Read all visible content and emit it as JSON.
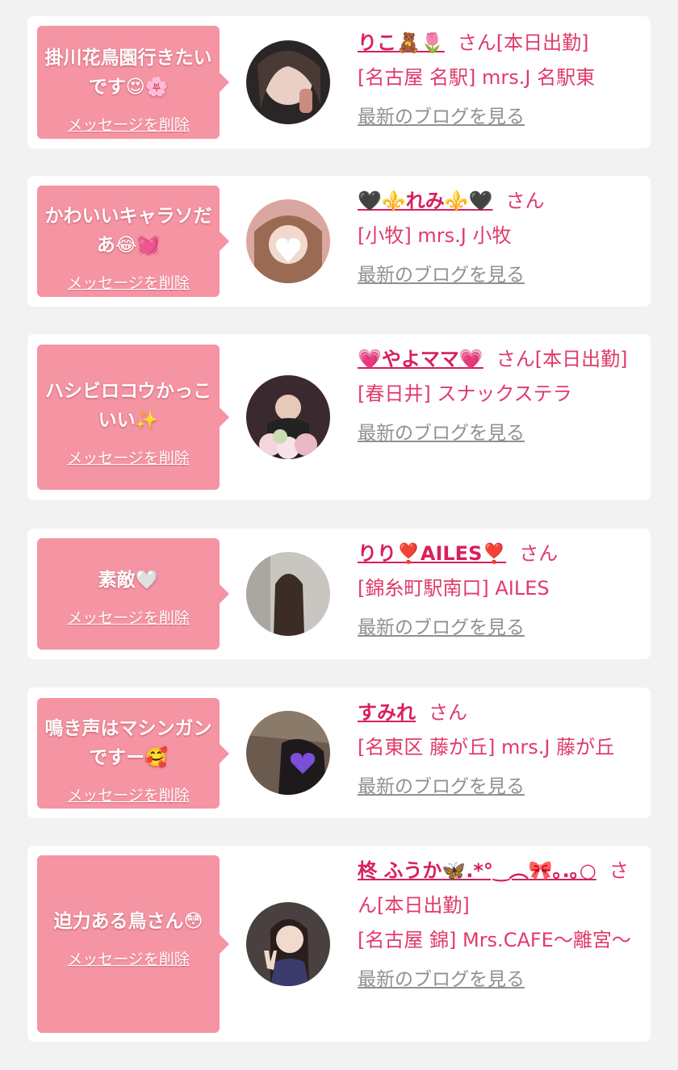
{
  "cards": [
    {
      "message": "掛川花鳥園行きたいです😍🌸",
      "delete_label": "メッセージを削除",
      "name": "りこ🧸🌷",
      "suffix": "さん[本日出勤]",
      "shop": "[名古屋 名駅] mrs.J 名駅東",
      "blog_label": "最新のブログを見る"
    },
    {
      "message": "かわいいキャラソだあ😂💓",
      "delete_label": "メッセージを削除",
      "name": "🖤⚜️れみ⚜️🖤",
      "suffix": "さん",
      "shop": "[小牧] mrs.J 小牧",
      "blog_label": "最新のブログを見る"
    },
    {
      "message": "ハシビロコウかっこいい✨",
      "delete_label": "メッセージを削除",
      "name": "💗やよママ💗",
      "suffix": "さん[本日出勤]",
      "shop": "[春日井] スナックステラ",
      "blog_label": "最新のブログを見る"
    },
    {
      "message": "素敵🤍",
      "delete_label": "メッセージを削除",
      "name": "りり❣️AILES❣️",
      "suffix": "さん",
      "shop": "[錦糸町駅南口] AILES",
      "blog_label": "最新のブログを見る"
    },
    {
      "message": "鳴き声はマシンガンですー🥰",
      "delete_label": "メッセージを削除",
      "name": "すみれ",
      "suffix": "さん",
      "shop": "[名東区 藤が丘] mrs.J 藤が丘",
      "blog_label": "最新のブログを見る"
    },
    {
      "message": "迫力ある鳥さん😳",
      "delete_label": "メッセージを削除",
      "name": "柊 ふうか🦋.*°‿︵🎀｡.｡○",
      "suffix": "さん[本日出勤]",
      "shop": "[名古屋 錦] Mrs.CAFE〜離宮〜",
      "blog_label": "最新のブログを見る"
    }
  ],
  "colors": {
    "page_bg": "#f2f2f2",
    "card_bg": "#ffffff",
    "bubble_bg": "#f594a3",
    "accent_text": "#e03a6b",
    "name_text": "#d8205a",
    "link_gray": "#909090"
  }
}
